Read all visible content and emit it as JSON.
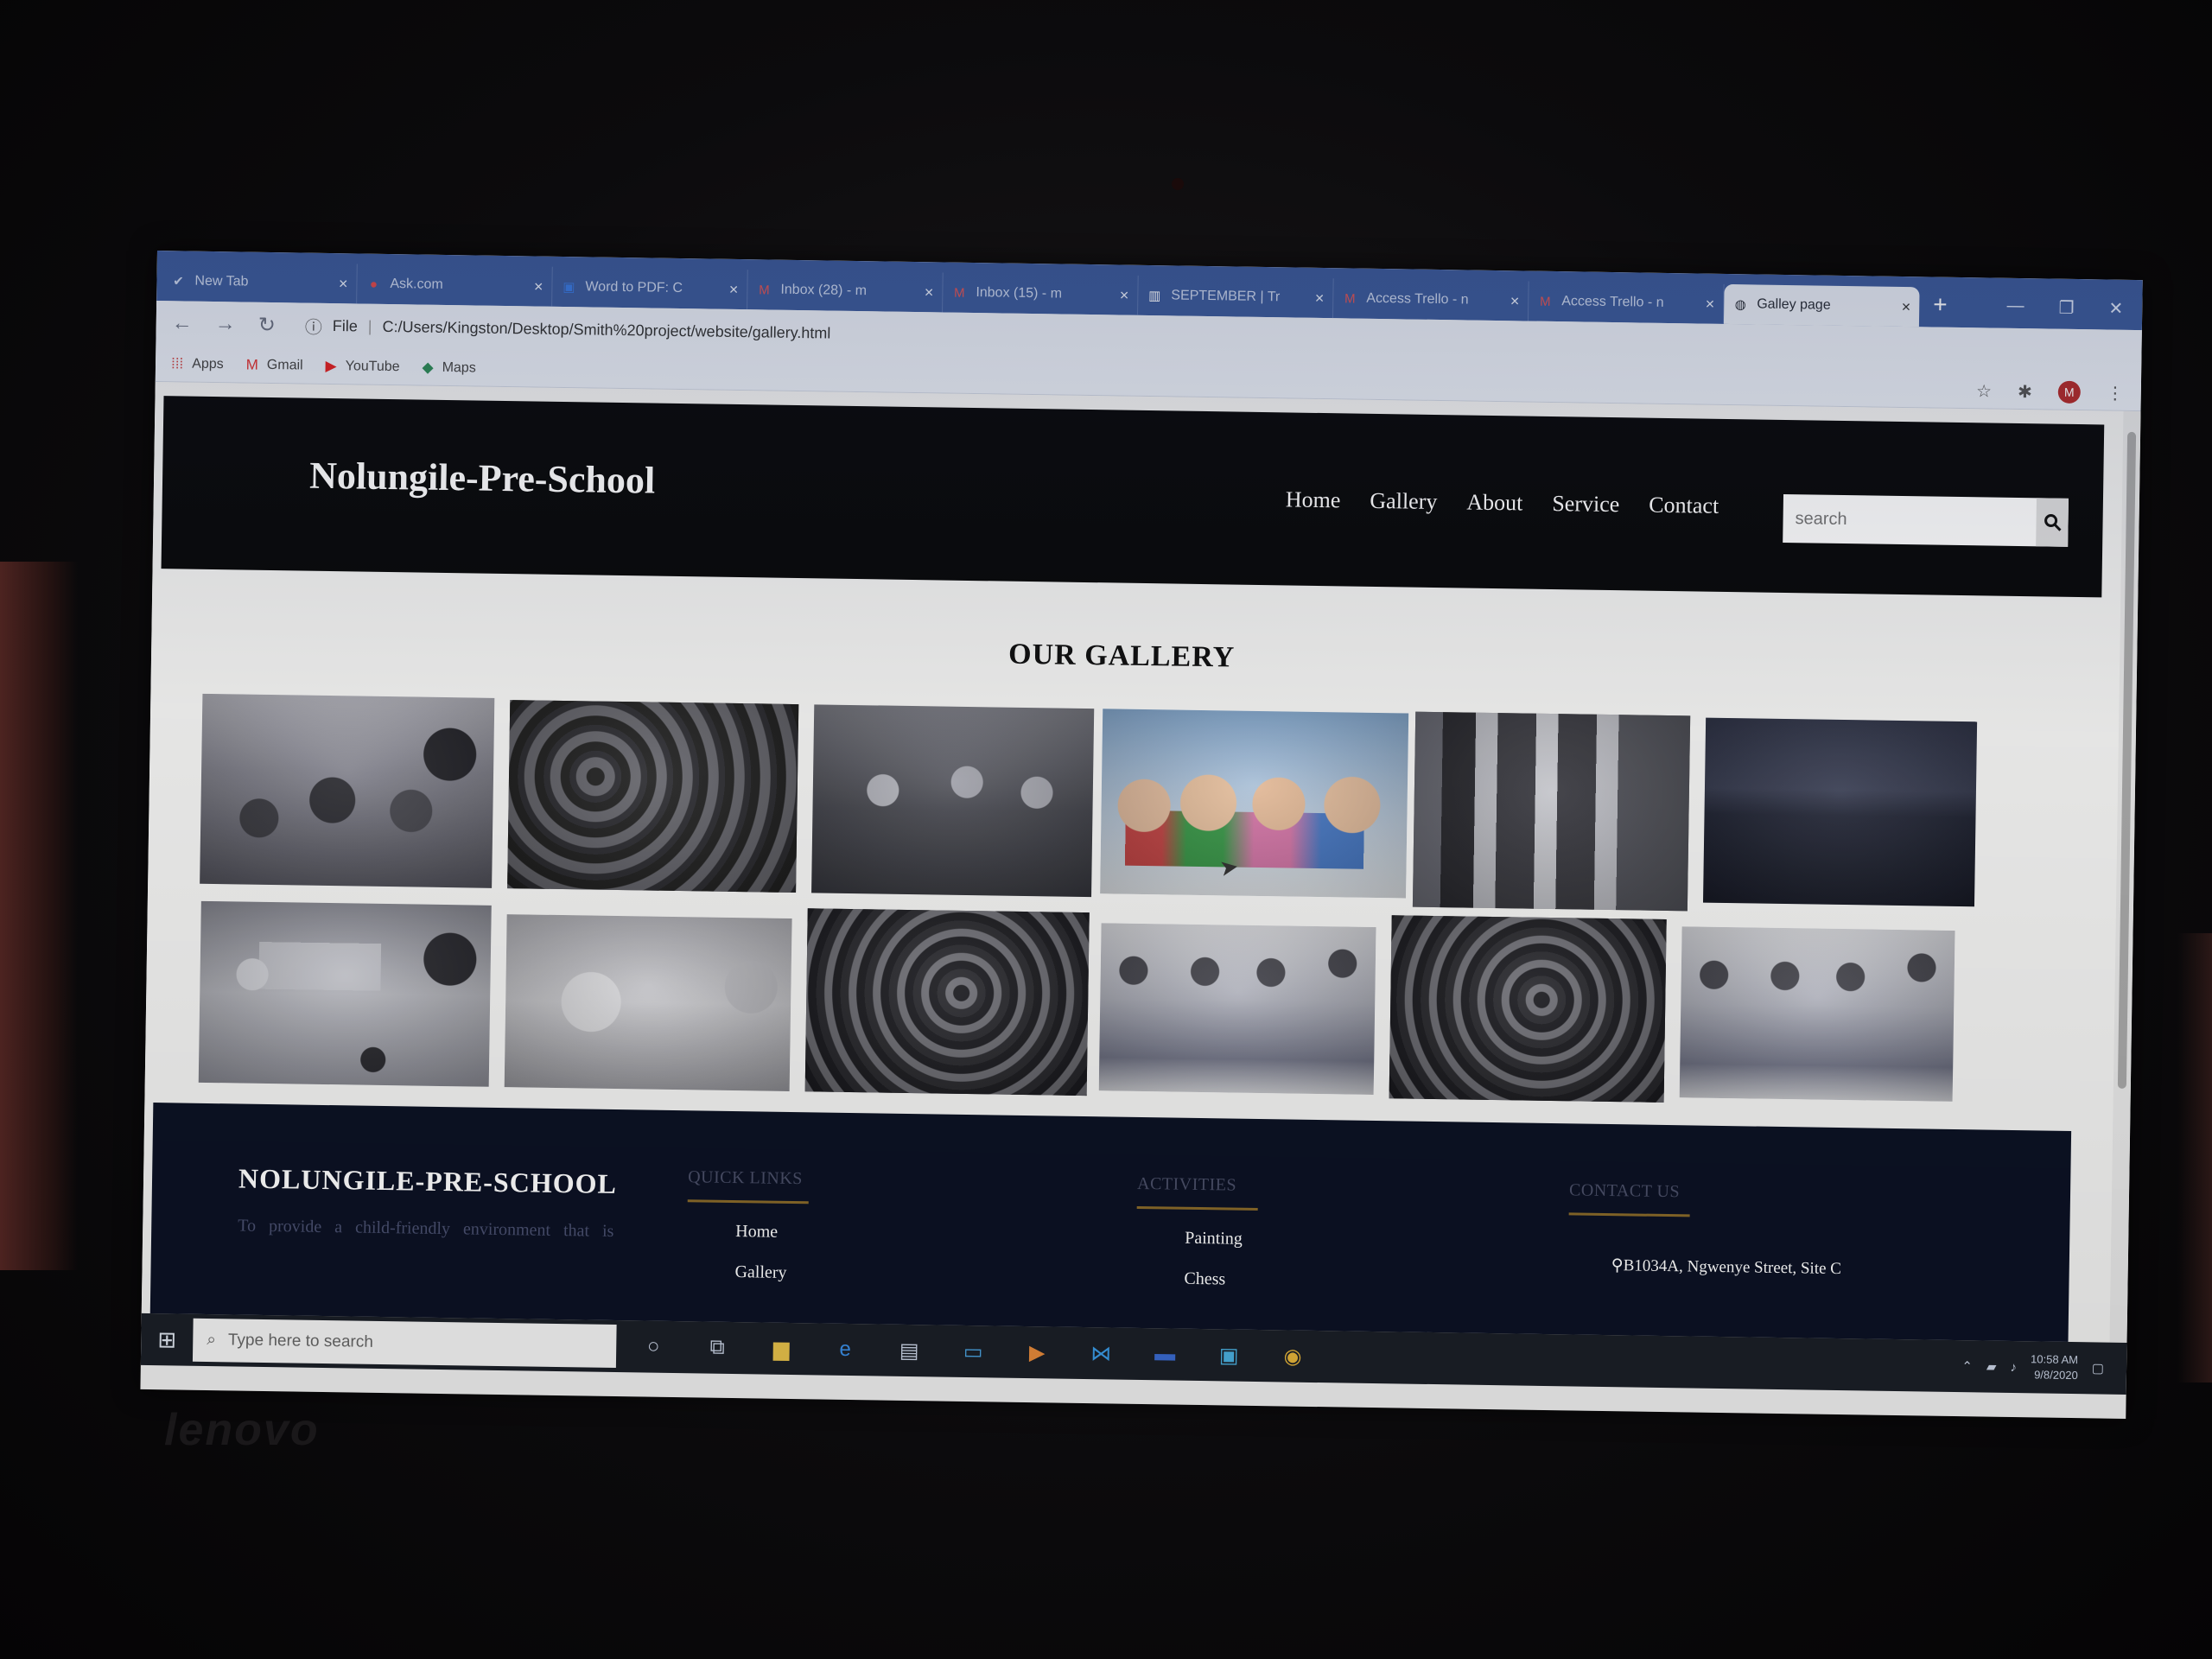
{
  "browser": {
    "tabs": [
      {
        "label": "New Tab",
        "icon": "new-tab-icon"
      },
      {
        "label": "Ask.com",
        "icon": "ask-icon"
      },
      {
        "label": "Word to PDF: C",
        "icon": "word-pdf-icon"
      },
      {
        "label": "Inbox (28) - m",
        "icon": "gmail-icon"
      },
      {
        "label": "Inbox (15) - m",
        "icon": "gmail-icon"
      },
      {
        "label": "SEPTEMBER | Tr",
        "icon": "trello-icon"
      },
      {
        "label": "Access Trello - n",
        "icon": "gmail-icon"
      },
      {
        "label": "Access Trello - n",
        "icon": "gmail-icon"
      },
      {
        "label": "Galley page",
        "icon": "globe-icon",
        "active": true
      }
    ],
    "address": {
      "scheme": "File",
      "url": "C:/Users/Kingston/Desktop/Smith%20project/website/gallery.html"
    },
    "bookmarks": [
      {
        "label": "Apps",
        "icon": "apps-grid-icon"
      },
      {
        "label": "Gmail",
        "icon": "gmail-icon"
      },
      {
        "label": "YouTube",
        "icon": "youtube-icon"
      },
      {
        "label": "Maps",
        "icon": "maps-icon"
      }
    ],
    "profile_initial": "M"
  },
  "site": {
    "logo": "Nolungile-Pre-School",
    "nav": [
      "Home",
      "Gallery",
      "About",
      "Service",
      "Contact"
    ],
    "search_placeholder": "search",
    "gallery_title": "OUR GALLERY",
    "gallery_images": [
      "classroom-children",
      "kids-crowd",
      "kids-sitting-floor",
      "four-kids-smiling",
      "graduation-group",
      "ocean-shore",
      "desk-laptop-flatlay",
      "kids-faces-closeup",
      "kids-crowd-2",
      "kids-playing-blocks",
      "kids-crowd-3",
      "kids-playing-blocks-2"
    ]
  },
  "footer": {
    "brand": "NOLUNGILE-PRE-SCHOOL",
    "description": "To provide a child-friendly environment that is",
    "quick_links": {
      "heading": "QUICK LINKS",
      "items": [
        "Home",
        "Gallery"
      ]
    },
    "activities": {
      "heading": "ACTIVITIES",
      "items": [
        "Painting",
        "Chess"
      ]
    },
    "contact": {
      "heading": "CONTACT US",
      "address": "B1034A, Ngwenye Street, Site C"
    }
  },
  "taskbar": {
    "search_placeholder": "Type here to search",
    "time": "10:58 AM",
    "date": "9/8/2020"
  },
  "device": {
    "brand": "lenovo"
  },
  "colors": {
    "header_bg": "#0a0a0b",
    "footer_bg": "#0c1224",
    "footer_accent_line": "#8a6a2a",
    "tabstrip": "#3c5a9a",
    "page_bg": "#f1f1f0"
  }
}
